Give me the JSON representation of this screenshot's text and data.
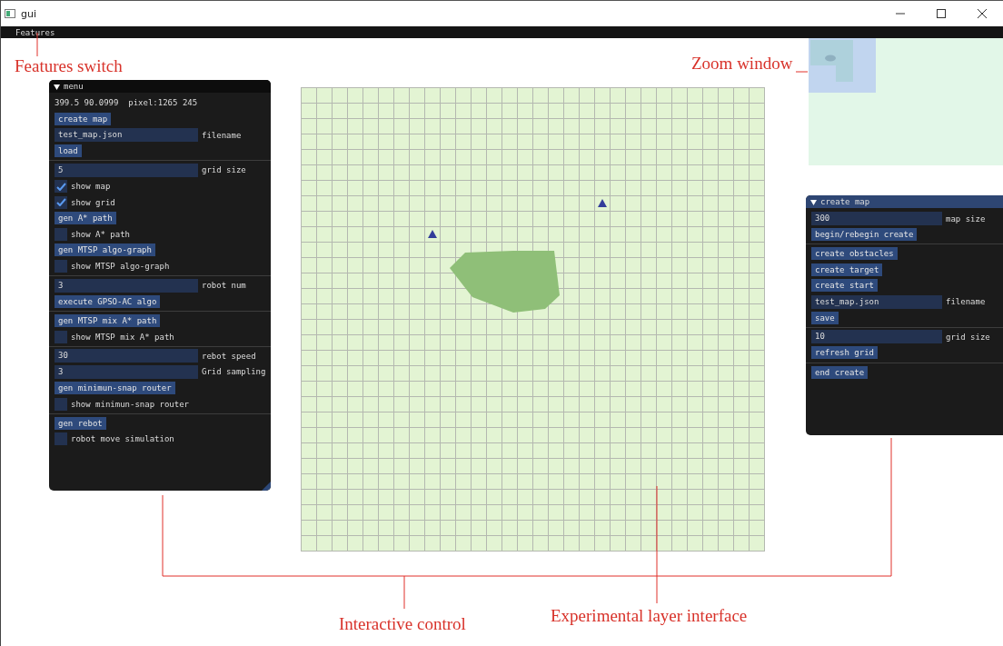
{
  "window": {
    "title": "gui"
  },
  "menubar": [
    "Features"
  ],
  "menu_panel": {
    "title": "menu",
    "active": false,
    "items": [
      {
        "kind": "text",
        "text": "399.5 90.0999  pixel:1265 245"
      },
      {
        "kind": "button",
        "text": "create map"
      },
      {
        "kind": "input",
        "value": "test_map.json",
        "caption": "filename"
      },
      {
        "kind": "button",
        "text": "load"
      },
      {
        "kind": "separator"
      },
      {
        "kind": "input",
        "value": "5",
        "caption": "grid size"
      },
      {
        "kind": "checkbox",
        "label": "show map",
        "checked": true
      },
      {
        "kind": "checkbox",
        "label": "show grid",
        "checked": true
      },
      {
        "kind": "button",
        "text": "gen A* path"
      },
      {
        "kind": "checkbox",
        "label": "show A* path",
        "checked": false
      },
      {
        "kind": "button",
        "text": "gen MTSP algo-graph"
      },
      {
        "kind": "checkbox",
        "label": "show MTSP algo-graph",
        "checked": false
      },
      {
        "kind": "separator"
      },
      {
        "kind": "input",
        "value": "3",
        "caption": "robot num"
      },
      {
        "kind": "button",
        "text": "execute GPSO-AC algo"
      },
      {
        "kind": "separator"
      },
      {
        "kind": "button",
        "text": "gen MTSP mix A* path"
      },
      {
        "kind": "checkbox",
        "label": "show MTSP mix A* path",
        "checked": false
      },
      {
        "kind": "separator"
      },
      {
        "kind": "input",
        "value": "30",
        "caption": "rebot speed"
      },
      {
        "kind": "input",
        "value": "3",
        "caption": "Grid sampling"
      },
      {
        "kind": "button",
        "text": "gen minimun-snap router"
      },
      {
        "kind": "checkbox",
        "label": "show minimun-snap router",
        "checked": false
      },
      {
        "kind": "separator"
      },
      {
        "kind": "button",
        "text": "gen rebot"
      },
      {
        "kind": "checkbox",
        "label": "robot move simulation",
        "checked": false
      }
    ]
  },
  "create_panel": {
    "title": "create map",
    "active": true,
    "items": [
      {
        "kind": "input",
        "value": "300",
        "caption": "map size"
      },
      {
        "kind": "button",
        "text": "begin/rebegin create"
      },
      {
        "kind": "separator"
      },
      {
        "kind": "button",
        "text": "create obstacles"
      },
      {
        "kind": "button",
        "text": "create target"
      },
      {
        "kind": "button",
        "text": "create start"
      },
      {
        "kind": "input",
        "value": "test_map.json",
        "caption": "filename"
      },
      {
        "kind": "button",
        "text": "save"
      },
      {
        "kind": "separator"
      },
      {
        "kind": "input",
        "value": "10",
        "caption": "grid size"
      },
      {
        "kind": "button",
        "text": "refresh grid"
      },
      {
        "kind": "separator"
      },
      {
        "kind": "button",
        "text": "end create"
      }
    ]
  },
  "annotations": [
    {
      "kind": "features",
      "text": "Features switch"
    },
    {
      "kind": "zoom",
      "text": "Zoom window"
    },
    {
      "kind": "interactive",
      "text": "Interactive control"
    },
    {
      "kind": "experimental",
      "text": "Experimental layer interface"
    }
  ]
}
